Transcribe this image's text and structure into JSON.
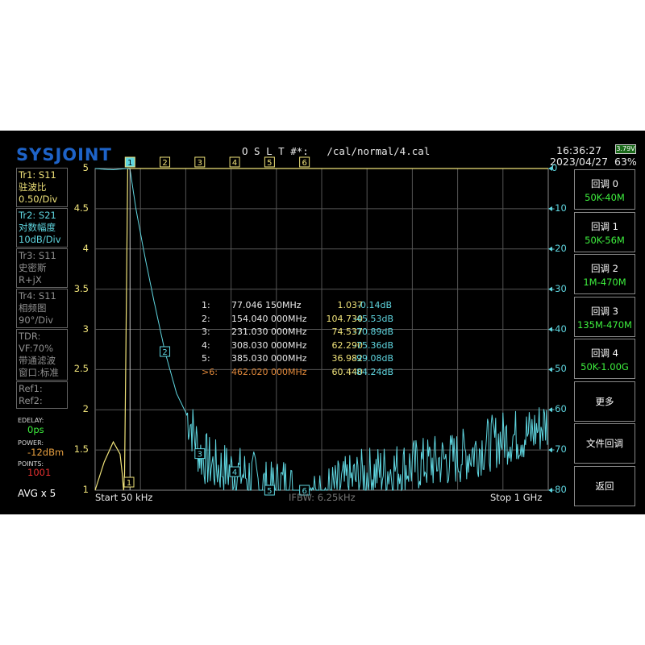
{
  "header": {
    "logo": "SYSJOINT",
    "cal": "O S L T #*:   /cal/normal/4.cal",
    "time": "16:36:27",
    "date": "2023/04/27",
    "battery_level": "3.79V",
    "battery_pct": "63%"
  },
  "traces": [
    {
      "title": "Tr1:  S11",
      "format": "驻波比",
      "scale": "0.50/Div",
      "color": "#f0e37a"
    },
    {
      "title": "Tr2:  S21",
      "format": "对数幅度",
      "scale": "10dB/Div",
      "color": "#5fd6e0"
    },
    {
      "title": "Tr3:  S11",
      "format": "史密斯",
      "scale": "R+jX"
    },
    {
      "title": "Tr4:  S11",
      "format": "相频图",
      "scale": "90°/Div"
    }
  ],
  "tdr": {
    "line1": "TDR:",
    "line2": "VF:70%",
    "line3": "带通滤波",
    "line4": "窗口:标准"
  },
  "refs": [
    "Ref1:",
    "Ref2:"
  ],
  "edelay": {
    "label": "EDELAY:",
    "value": "0ps"
  },
  "power": {
    "label": "POWER:",
    "value": "-12dBm"
  },
  "points": {
    "label": "POINTS:",
    "value": "1001"
  },
  "avg": "AVG x 5",
  "bottom": {
    "start": "Start   50 kHz",
    "ifbw": "IFBW: 6.25kHz",
    "stop": "Stop   1 GHz"
  },
  "right_buttons": [
    {
      "l1": "回调 0",
      "l2": "50K-40M"
    },
    {
      "l1": "回调 1",
      "l2": "50K-56M"
    },
    {
      "l1": "回调 2",
      "l2": "1M-470M"
    },
    {
      "l1": "回调 3",
      "l2": "135M-470M"
    },
    {
      "l1": "回调 4",
      "l2": "50K-1.00G"
    },
    {
      "l1": "更多",
      "l2": ""
    },
    {
      "l1": "文件回调",
      "l2": ""
    },
    {
      "l1": "返回",
      "l2": ""
    }
  ],
  "markers": [
    {
      "idx": "1:",
      "freq": "77.046 150MHz",
      "v1": "1.037",
      "v2": "-0.14dB"
    },
    {
      "idx": "2:",
      "freq": "154.040 000MHz",
      "v1": "104.730",
      "v2": "-45.53dB"
    },
    {
      "idx": "3:",
      "freq": "231.030 000MHz",
      "v1": "74.537",
      "v2": "-70.89dB"
    },
    {
      "idx": "4:",
      "freq": "308.030 000MHz",
      "v1": "62.290",
      "v2": "-75.36dB"
    },
    {
      "idx": "5:",
      "freq": "385.030 000MHz",
      "v1": "36.982",
      "v2": "-99.08dB"
    },
    {
      "idx": ">6:",
      "freq": "462.020 000MHz",
      "v1": "60.440",
      "v2": "-84.24dB",
      "active": true
    }
  ],
  "marker_labels": [
    "1",
    "2",
    "3",
    "4",
    "5",
    "6"
  ],
  "axes": {
    "left_ticks": [
      "5",
      "4.5",
      "4",
      "3.5",
      "3",
      "2.5",
      "2",
      "1.5",
      "1"
    ],
    "right_ticks": [
      "0",
      "-10",
      "-20",
      "-30",
      "-40",
      "-50",
      "-60",
      "-70",
      "-80"
    ]
  },
  "colors": {
    "s11": "#f0e37a",
    "s21": "#5fd6e0",
    "active_marker": "#e0883a",
    "button_value": "#3ef03e",
    "logo": "#1e63c8"
  },
  "chart_data": {
    "type": "line",
    "xlabel": "",
    "ylabel": "",
    "x_range_hz": [
      50000,
      1000000000
    ],
    "y_left_range": [
      1,
      5
    ],
    "y_right_range_db": [
      -80,
      0
    ],
    "series": [
      {
        "name": "S11",
        "x_mhz": [
          0,
          20,
          40,
          55,
          60,
          62,
          63,
          65,
          68,
          72,
          77,
          100,
          200,
          300,
          400,
          500,
          600,
          700,
          800,
          900,
          1000
        ],
        "values": [
          1.0,
          1.35,
          1.6,
          1.45,
          1.2,
          1.05,
          1.0,
          1.2,
          2.8,
          5.0,
          5.0,
          5.0,
          5.0,
          5.0,
          5.0,
          5.0,
          5.0,
          5.0,
          5.0,
          5.0,
          5.0
        ]
      },
      {
        "name": "S21",
        "x_mhz": [
          0,
          20,
          40,
          60,
          70,
          77,
          90,
          110,
          130,
          154,
          180,
          210,
          231,
          260,
          308,
          350,
          385,
          420,
          462,
          520,
          600,
          700,
          800,
          900,
          960,
          1000
        ],
        "values": [
          0,
          -0.2,
          -0.3,
          -0.1,
          0,
          -0.14,
          -10,
          -22,
          -33,
          -45.5,
          -56,
          -63,
          -70.9,
          -74,
          -75.4,
          -77,
          -80,
          -78,
          -84,
          -80,
          -76,
          -74,
          -72,
          -67,
          -66,
          -63
        ]
      }
    ],
    "markers_mhz": [
      77.046,
      154.04,
      231.03,
      308.03,
      385.03,
      462.02
    ]
  }
}
